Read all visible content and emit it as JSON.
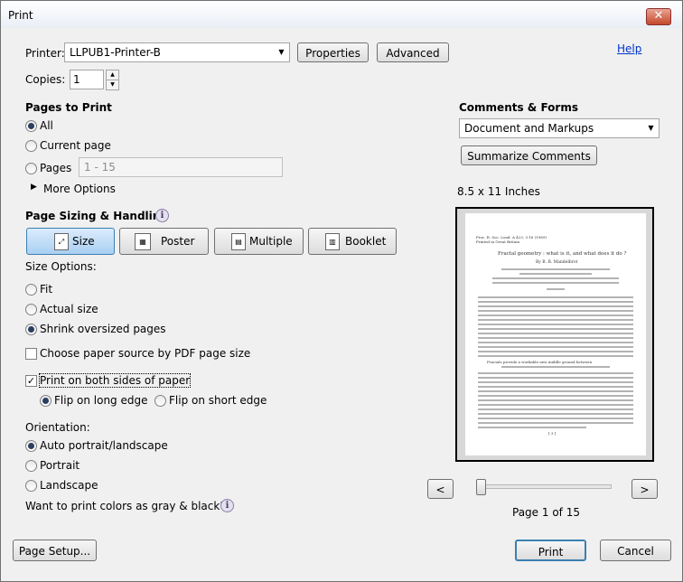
{
  "window": {
    "title": "Print",
    "close_glyph": "✕"
  },
  "help_label": "Help",
  "printer": {
    "label": "Printer:",
    "value": "LLPUB1-Printer-B",
    "properties_label": "Properties",
    "advanced_label": "Advanced"
  },
  "copies": {
    "label": "Copies:",
    "value": "1"
  },
  "pages_to_print": {
    "heading": "Pages to Print",
    "all_label": "All",
    "current_label": "Current page",
    "pages_label": "Pages",
    "pages_range": "1 - 15",
    "more_options_label": "More Options",
    "selected": "all"
  },
  "sizing": {
    "heading": "Page Sizing & Handling",
    "modes": [
      "Size",
      "Poster",
      "Multiple",
      "Booklet"
    ],
    "selected_mode": "Size",
    "size_options_label": "Size Options:",
    "fit_label": "Fit",
    "actual_label": "Actual size",
    "shrink_label": "Shrink oversized pages",
    "selected_option": "shrink",
    "paper_source_label": "Choose paper source by PDF page size",
    "paper_source_checked": false,
    "both_sides_label": "Print on both sides of paper",
    "both_sides_checked": true,
    "flip_long_label": "Flip on long edge",
    "flip_short_label": "Flip on short edge",
    "flip_selected": "long"
  },
  "orientation": {
    "heading": "Orientation:",
    "auto_label": "Auto portrait/landscape",
    "portrait_label": "Portrait",
    "landscape_label": "Landscape",
    "selected": "auto"
  },
  "gray_label": "Want to print colors as gray & black?",
  "comments": {
    "heading": "Comments & Forms",
    "value": "Document and Markups",
    "summarize_label": "Summarize Comments"
  },
  "preview": {
    "paper_size": "8.5 x 11 Inches",
    "page_label": "Page 1 of 15",
    "prev_glyph": "<",
    "next_glyph": ">",
    "current_page": 1,
    "total_pages": 15,
    "doc_title": "Fractal geometry : what is it, and what does it do ?",
    "doc_author": "By B. B. Mandelbrot",
    "section_heading": "Fractals provide a workable new middle ground between",
    "footer": "[ 3 ]"
  },
  "footer": {
    "page_setup_label": "Page Setup...",
    "print_label": "Print",
    "cancel_label": "Cancel"
  },
  "icons": {
    "info": "info-icon",
    "dropdown": "chevron-down-icon",
    "expand": "triangle-right-icon"
  }
}
